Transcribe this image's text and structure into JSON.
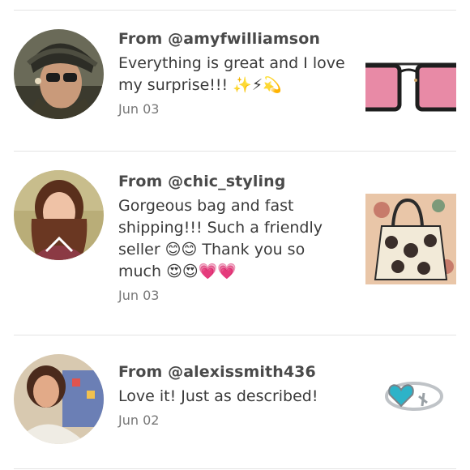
{
  "reviews": [
    {
      "user": "From @amyfwilliamson",
      "comment": "Everything is great and I love my surprise!!! ✨⚡💫",
      "date": "Jun 03",
      "product_icon": "pink-sunglasses-image"
    },
    {
      "user": "From @chic_styling",
      "comment": "Gorgeous bag and fast shipping!!! Such a friendly seller 😊😊 Thank you so much 😍😍💗💗",
      "date": "Jun 03",
      "product_icon": "floral-tote-bag-image"
    },
    {
      "user": "From @alexissmith436",
      "comment": "Love it! Just as described!",
      "date": "Jun 02",
      "product_icon": "heart-ring-image"
    }
  ]
}
